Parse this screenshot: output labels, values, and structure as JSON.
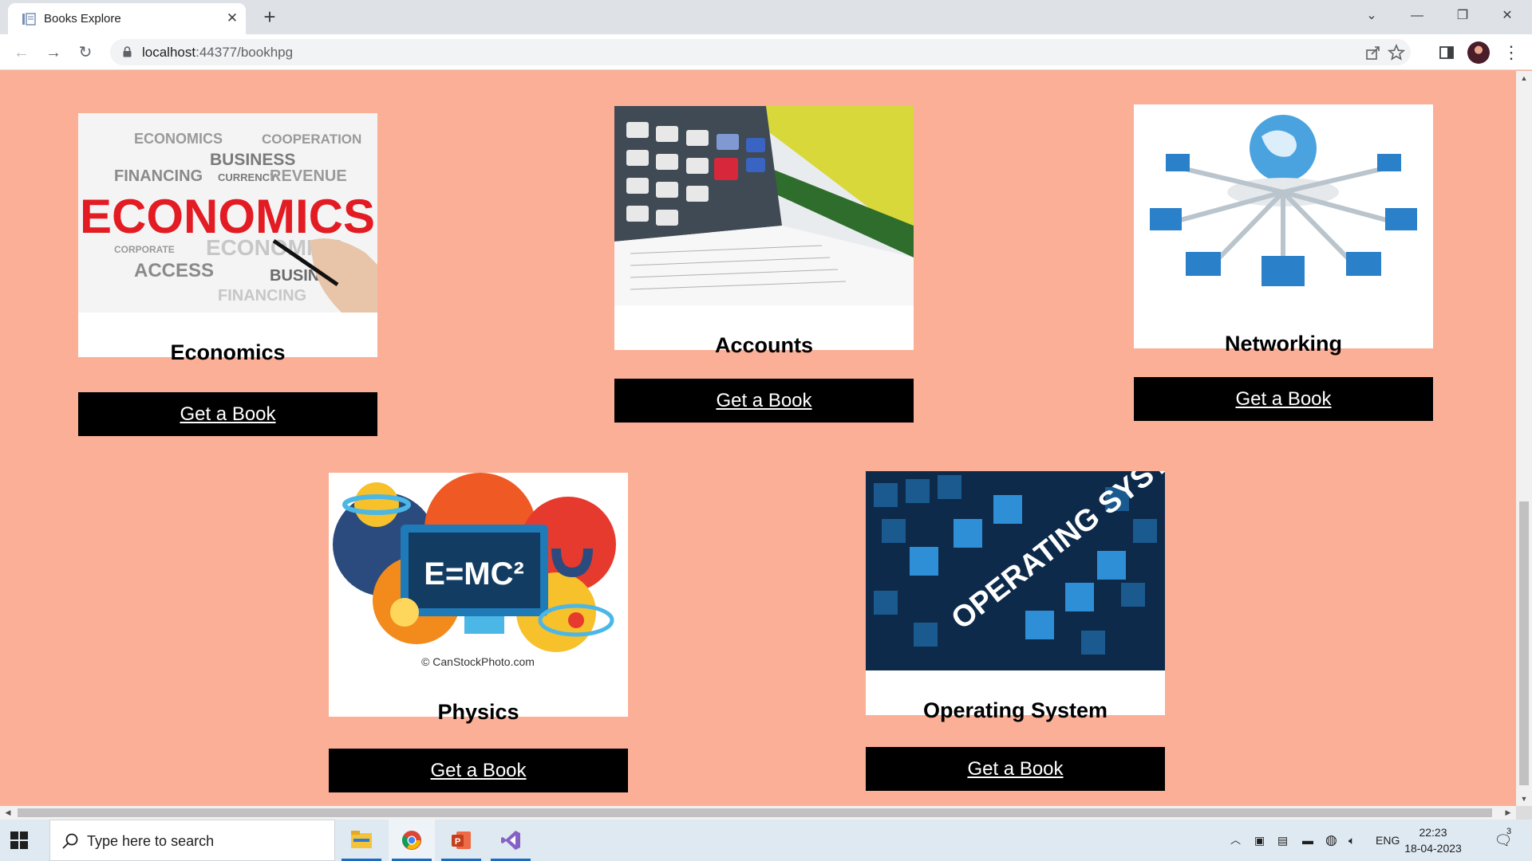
{
  "browser": {
    "tab_title": "Books Explore",
    "url_host": "localhost",
    "url_rest": ":44377/bookhpg"
  },
  "books": [
    {
      "title": "Economics",
      "button": "Get a Book",
      "image_text": "ECONOMICS"
    },
    {
      "title": "Accounts",
      "button": "Get a Book"
    },
    {
      "title": "Networking",
      "button": "Get a Book"
    },
    {
      "title": "Physics",
      "button": "Get a Book",
      "image_text": "E=MC²",
      "image_credit": "© CanStockPhoto.com"
    },
    {
      "title": "Operating System",
      "button": "Get a Book",
      "image_text": "OPERATING SYSTEM"
    }
  ],
  "taskbar": {
    "search_placeholder": "Type here to search",
    "language": "ENG",
    "time": "22:23",
    "date": "18-04-2023",
    "notification_count": "3"
  },
  "colors": {
    "page_background": "#fbaf97",
    "button_background": "#000000",
    "button_text": "#ffffff"
  }
}
